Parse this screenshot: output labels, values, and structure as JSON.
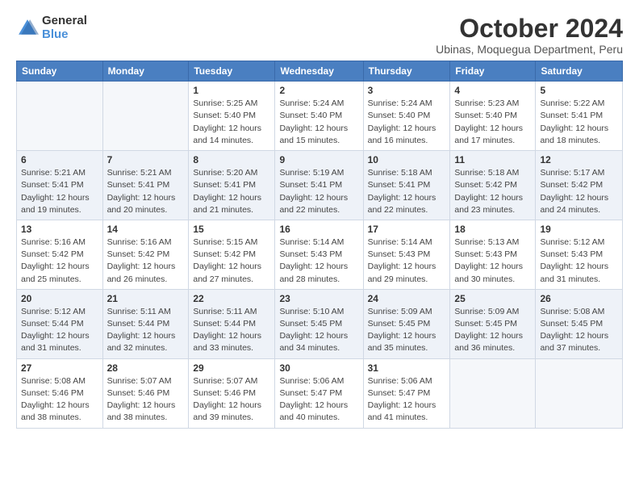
{
  "logo": {
    "general": "General",
    "blue": "Blue"
  },
  "title": "October 2024",
  "subtitle": "Ubinas, Moquegua Department, Peru",
  "weekdays": [
    "Sunday",
    "Monday",
    "Tuesday",
    "Wednesday",
    "Thursday",
    "Friday",
    "Saturday"
  ],
  "weeks": [
    [
      {
        "day": "",
        "sunrise": "",
        "sunset": "",
        "daylight": "",
        "empty": true
      },
      {
        "day": "",
        "sunrise": "",
        "sunset": "",
        "daylight": "",
        "empty": true
      },
      {
        "day": "1",
        "sunrise": "Sunrise: 5:25 AM",
        "sunset": "Sunset: 5:40 PM",
        "daylight": "Daylight: 12 hours and 14 minutes."
      },
      {
        "day": "2",
        "sunrise": "Sunrise: 5:24 AM",
        "sunset": "Sunset: 5:40 PM",
        "daylight": "Daylight: 12 hours and 15 minutes."
      },
      {
        "day": "3",
        "sunrise": "Sunrise: 5:24 AM",
        "sunset": "Sunset: 5:40 PM",
        "daylight": "Daylight: 12 hours and 16 minutes."
      },
      {
        "day": "4",
        "sunrise": "Sunrise: 5:23 AM",
        "sunset": "Sunset: 5:40 PM",
        "daylight": "Daylight: 12 hours and 17 minutes."
      },
      {
        "day": "5",
        "sunrise": "Sunrise: 5:22 AM",
        "sunset": "Sunset: 5:41 PM",
        "daylight": "Daylight: 12 hours and 18 minutes."
      }
    ],
    [
      {
        "day": "6",
        "sunrise": "Sunrise: 5:21 AM",
        "sunset": "Sunset: 5:41 PM",
        "daylight": "Daylight: 12 hours and 19 minutes."
      },
      {
        "day": "7",
        "sunrise": "Sunrise: 5:21 AM",
        "sunset": "Sunset: 5:41 PM",
        "daylight": "Daylight: 12 hours and 20 minutes."
      },
      {
        "day": "8",
        "sunrise": "Sunrise: 5:20 AM",
        "sunset": "Sunset: 5:41 PM",
        "daylight": "Daylight: 12 hours and 21 minutes."
      },
      {
        "day": "9",
        "sunrise": "Sunrise: 5:19 AM",
        "sunset": "Sunset: 5:41 PM",
        "daylight": "Daylight: 12 hours and 22 minutes."
      },
      {
        "day": "10",
        "sunrise": "Sunrise: 5:18 AM",
        "sunset": "Sunset: 5:41 PM",
        "daylight": "Daylight: 12 hours and 22 minutes."
      },
      {
        "day": "11",
        "sunrise": "Sunrise: 5:18 AM",
        "sunset": "Sunset: 5:42 PM",
        "daylight": "Daylight: 12 hours and 23 minutes."
      },
      {
        "day": "12",
        "sunrise": "Sunrise: 5:17 AM",
        "sunset": "Sunset: 5:42 PM",
        "daylight": "Daylight: 12 hours and 24 minutes."
      }
    ],
    [
      {
        "day": "13",
        "sunrise": "Sunrise: 5:16 AM",
        "sunset": "Sunset: 5:42 PM",
        "daylight": "Daylight: 12 hours and 25 minutes."
      },
      {
        "day": "14",
        "sunrise": "Sunrise: 5:16 AM",
        "sunset": "Sunset: 5:42 PM",
        "daylight": "Daylight: 12 hours and 26 minutes."
      },
      {
        "day": "15",
        "sunrise": "Sunrise: 5:15 AM",
        "sunset": "Sunset: 5:42 PM",
        "daylight": "Daylight: 12 hours and 27 minutes."
      },
      {
        "day": "16",
        "sunrise": "Sunrise: 5:14 AM",
        "sunset": "Sunset: 5:43 PM",
        "daylight": "Daylight: 12 hours and 28 minutes."
      },
      {
        "day": "17",
        "sunrise": "Sunrise: 5:14 AM",
        "sunset": "Sunset: 5:43 PM",
        "daylight": "Daylight: 12 hours and 29 minutes."
      },
      {
        "day": "18",
        "sunrise": "Sunrise: 5:13 AM",
        "sunset": "Sunset: 5:43 PM",
        "daylight": "Daylight: 12 hours and 30 minutes."
      },
      {
        "day": "19",
        "sunrise": "Sunrise: 5:12 AM",
        "sunset": "Sunset: 5:43 PM",
        "daylight": "Daylight: 12 hours and 31 minutes."
      }
    ],
    [
      {
        "day": "20",
        "sunrise": "Sunrise: 5:12 AM",
        "sunset": "Sunset: 5:44 PM",
        "daylight": "Daylight: 12 hours and 31 minutes."
      },
      {
        "day": "21",
        "sunrise": "Sunrise: 5:11 AM",
        "sunset": "Sunset: 5:44 PM",
        "daylight": "Daylight: 12 hours and 32 minutes."
      },
      {
        "day": "22",
        "sunrise": "Sunrise: 5:11 AM",
        "sunset": "Sunset: 5:44 PM",
        "daylight": "Daylight: 12 hours and 33 minutes."
      },
      {
        "day": "23",
        "sunrise": "Sunrise: 5:10 AM",
        "sunset": "Sunset: 5:45 PM",
        "daylight": "Daylight: 12 hours and 34 minutes."
      },
      {
        "day": "24",
        "sunrise": "Sunrise: 5:09 AM",
        "sunset": "Sunset: 5:45 PM",
        "daylight": "Daylight: 12 hours and 35 minutes."
      },
      {
        "day": "25",
        "sunrise": "Sunrise: 5:09 AM",
        "sunset": "Sunset: 5:45 PM",
        "daylight": "Daylight: 12 hours and 36 minutes."
      },
      {
        "day": "26",
        "sunrise": "Sunrise: 5:08 AM",
        "sunset": "Sunset: 5:45 PM",
        "daylight": "Daylight: 12 hours and 37 minutes."
      }
    ],
    [
      {
        "day": "27",
        "sunrise": "Sunrise: 5:08 AM",
        "sunset": "Sunset: 5:46 PM",
        "daylight": "Daylight: 12 hours and 38 minutes."
      },
      {
        "day": "28",
        "sunrise": "Sunrise: 5:07 AM",
        "sunset": "Sunset: 5:46 PM",
        "daylight": "Daylight: 12 hours and 38 minutes."
      },
      {
        "day": "29",
        "sunrise": "Sunrise: 5:07 AM",
        "sunset": "Sunset: 5:46 PM",
        "daylight": "Daylight: 12 hours and 39 minutes."
      },
      {
        "day": "30",
        "sunrise": "Sunrise: 5:06 AM",
        "sunset": "Sunset: 5:47 PM",
        "daylight": "Daylight: 12 hours and 40 minutes."
      },
      {
        "day": "31",
        "sunrise": "Sunrise: 5:06 AM",
        "sunset": "Sunset: 5:47 PM",
        "daylight": "Daylight: 12 hours and 41 minutes."
      },
      {
        "day": "",
        "sunrise": "",
        "sunset": "",
        "daylight": "",
        "empty": true
      },
      {
        "day": "",
        "sunrise": "",
        "sunset": "",
        "daylight": "",
        "empty": true
      }
    ]
  ]
}
